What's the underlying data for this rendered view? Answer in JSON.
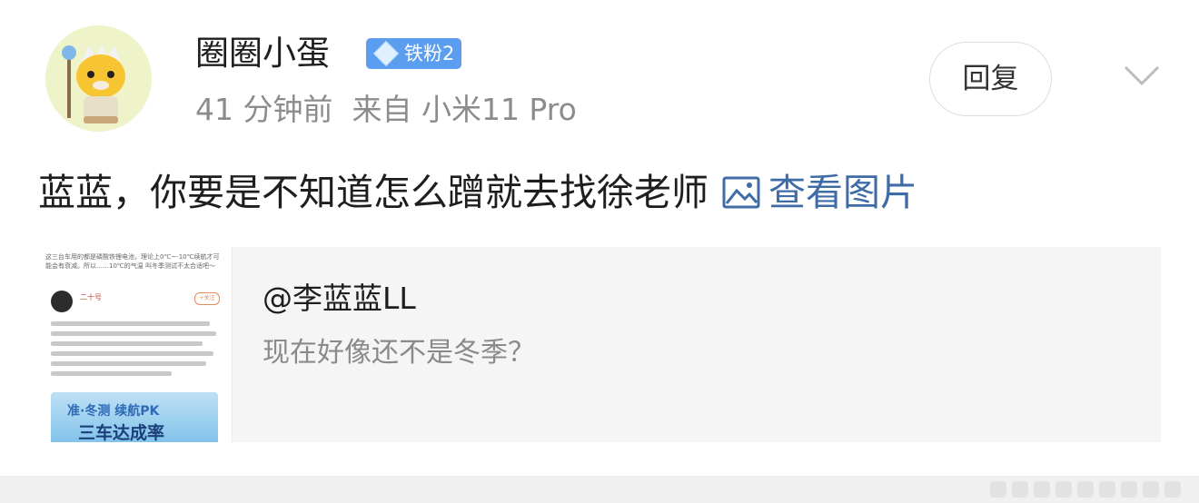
{
  "post": {
    "username": "圈圈小蛋",
    "badge": "铁粉2",
    "meta": "41 分钟前  来自 小米11 Pro",
    "reply_label": "回复",
    "content": "蓝蓝，你要是不知道怎么蹭就去找徐老师",
    "view_image_label": "查看图片"
  },
  "quote": {
    "user": "@李蓝蓝LL",
    "text": "现在好像还不是冬季？",
    "thumbnail": {
      "top_text": "这三台车用的都是磷酸铁锂电池，理论上0℃~-10℃续航才可能会有衰减。所以……10℃的气温 叫冬季测试不太合适吧～",
      "poster_name": "二十号",
      "follow_label": "+关注",
      "banner_line1": "准·冬测 续航PK",
      "banner_line2": "三车达成率"
    }
  },
  "colors": {
    "link": "#3f6ba6",
    "badge_bg": "#5b9ef0",
    "meta_text": "#8c8c8c",
    "quote_bg": "#f5f5f5"
  },
  "icons": [
    "avatar-tiger",
    "diamond-icon",
    "chevron-down-icon",
    "image-icon"
  ]
}
